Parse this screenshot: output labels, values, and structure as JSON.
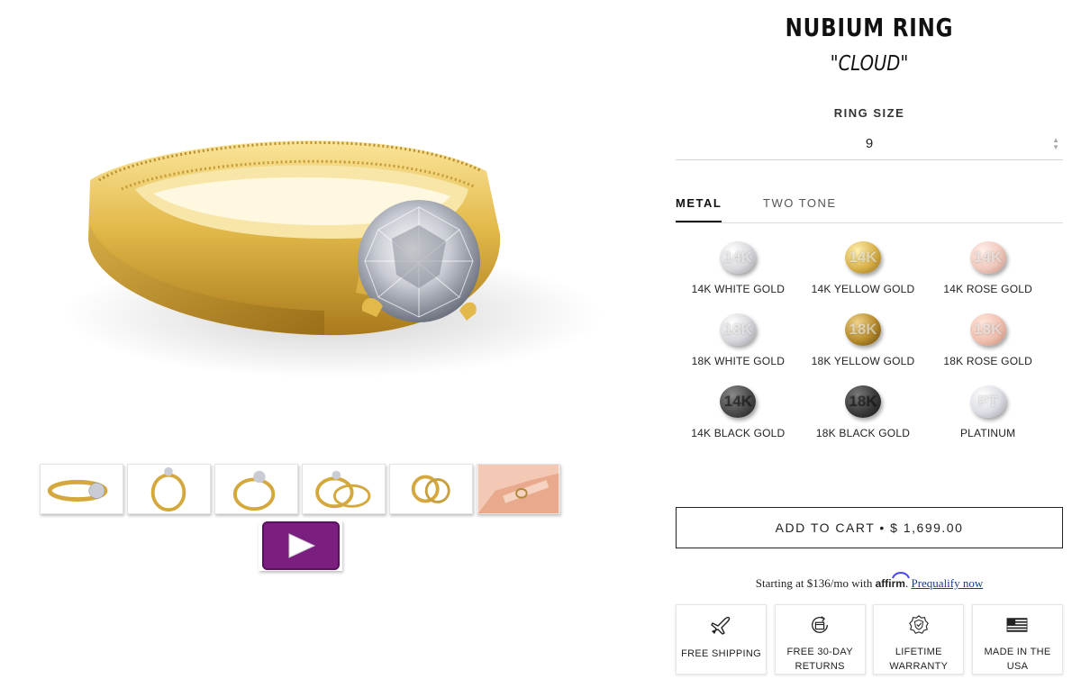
{
  "product": {
    "title": "NUBIUM RING",
    "subtitle": "\"CLOUD\""
  },
  "ring_size": {
    "label": "RING SIZE",
    "value": "9"
  },
  "tabs": [
    {
      "label": "METAL",
      "active": true
    },
    {
      "label": "TWO TONE",
      "active": false
    }
  ],
  "metals": [
    {
      "badge": "14K",
      "label": "14K WHITE GOLD",
      "color": "#d9d9de"
    },
    {
      "badge": "14K",
      "label": "14K YELLOW GOLD",
      "color": "#d9b14a"
    },
    {
      "badge": "14K",
      "label": "14K ROSE GOLD",
      "color": "#f0c8bc"
    },
    {
      "badge": "18K",
      "label": "18K WHITE GOLD",
      "color": "#d6d6dc"
    },
    {
      "badge": "18K",
      "label": "18K YELLOW GOLD",
      "color": "#b58a2a"
    },
    {
      "badge": "18K",
      "label": "18K ROSE GOLD",
      "color": "#f0c0b0"
    },
    {
      "badge": "14K",
      "label": "14K BLACK GOLD",
      "color": "#4a4a4a"
    },
    {
      "badge": "18K",
      "label": "18K BLACK GOLD",
      "color": "#3a3a3a"
    },
    {
      "badge": "PT",
      "label": "PLATINUM",
      "color": "#dcdde4"
    }
  ],
  "cart": {
    "label": "ADD TO CART • $ 1,699.00"
  },
  "financing": {
    "text": "Starting at $136/mo with",
    "brand": "affirm",
    "link": "Prequalify now"
  },
  "badges": [
    {
      "icon": "airplane-icon",
      "label": "FREE SHIPPING"
    },
    {
      "icon": "returns-box-icon",
      "label": "FREE 30-DAY RETURNS"
    },
    {
      "icon": "shield-check-icon",
      "label": "LIFETIME WARRANTY"
    },
    {
      "icon": "us-flag-icon",
      "label": "MADE IN THE USA"
    }
  ],
  "gallery": {
    "thumbnails": [
      "ring-angle-view",
      "ring-front-view",
      "ring-side-view",
      "ring-set-view",
      "ring-top-view",
      "ring-on-hand-view"
    ],
    "video_thumbnail": "play-video",
    "accent": "#7a1f7f"
  }
}
